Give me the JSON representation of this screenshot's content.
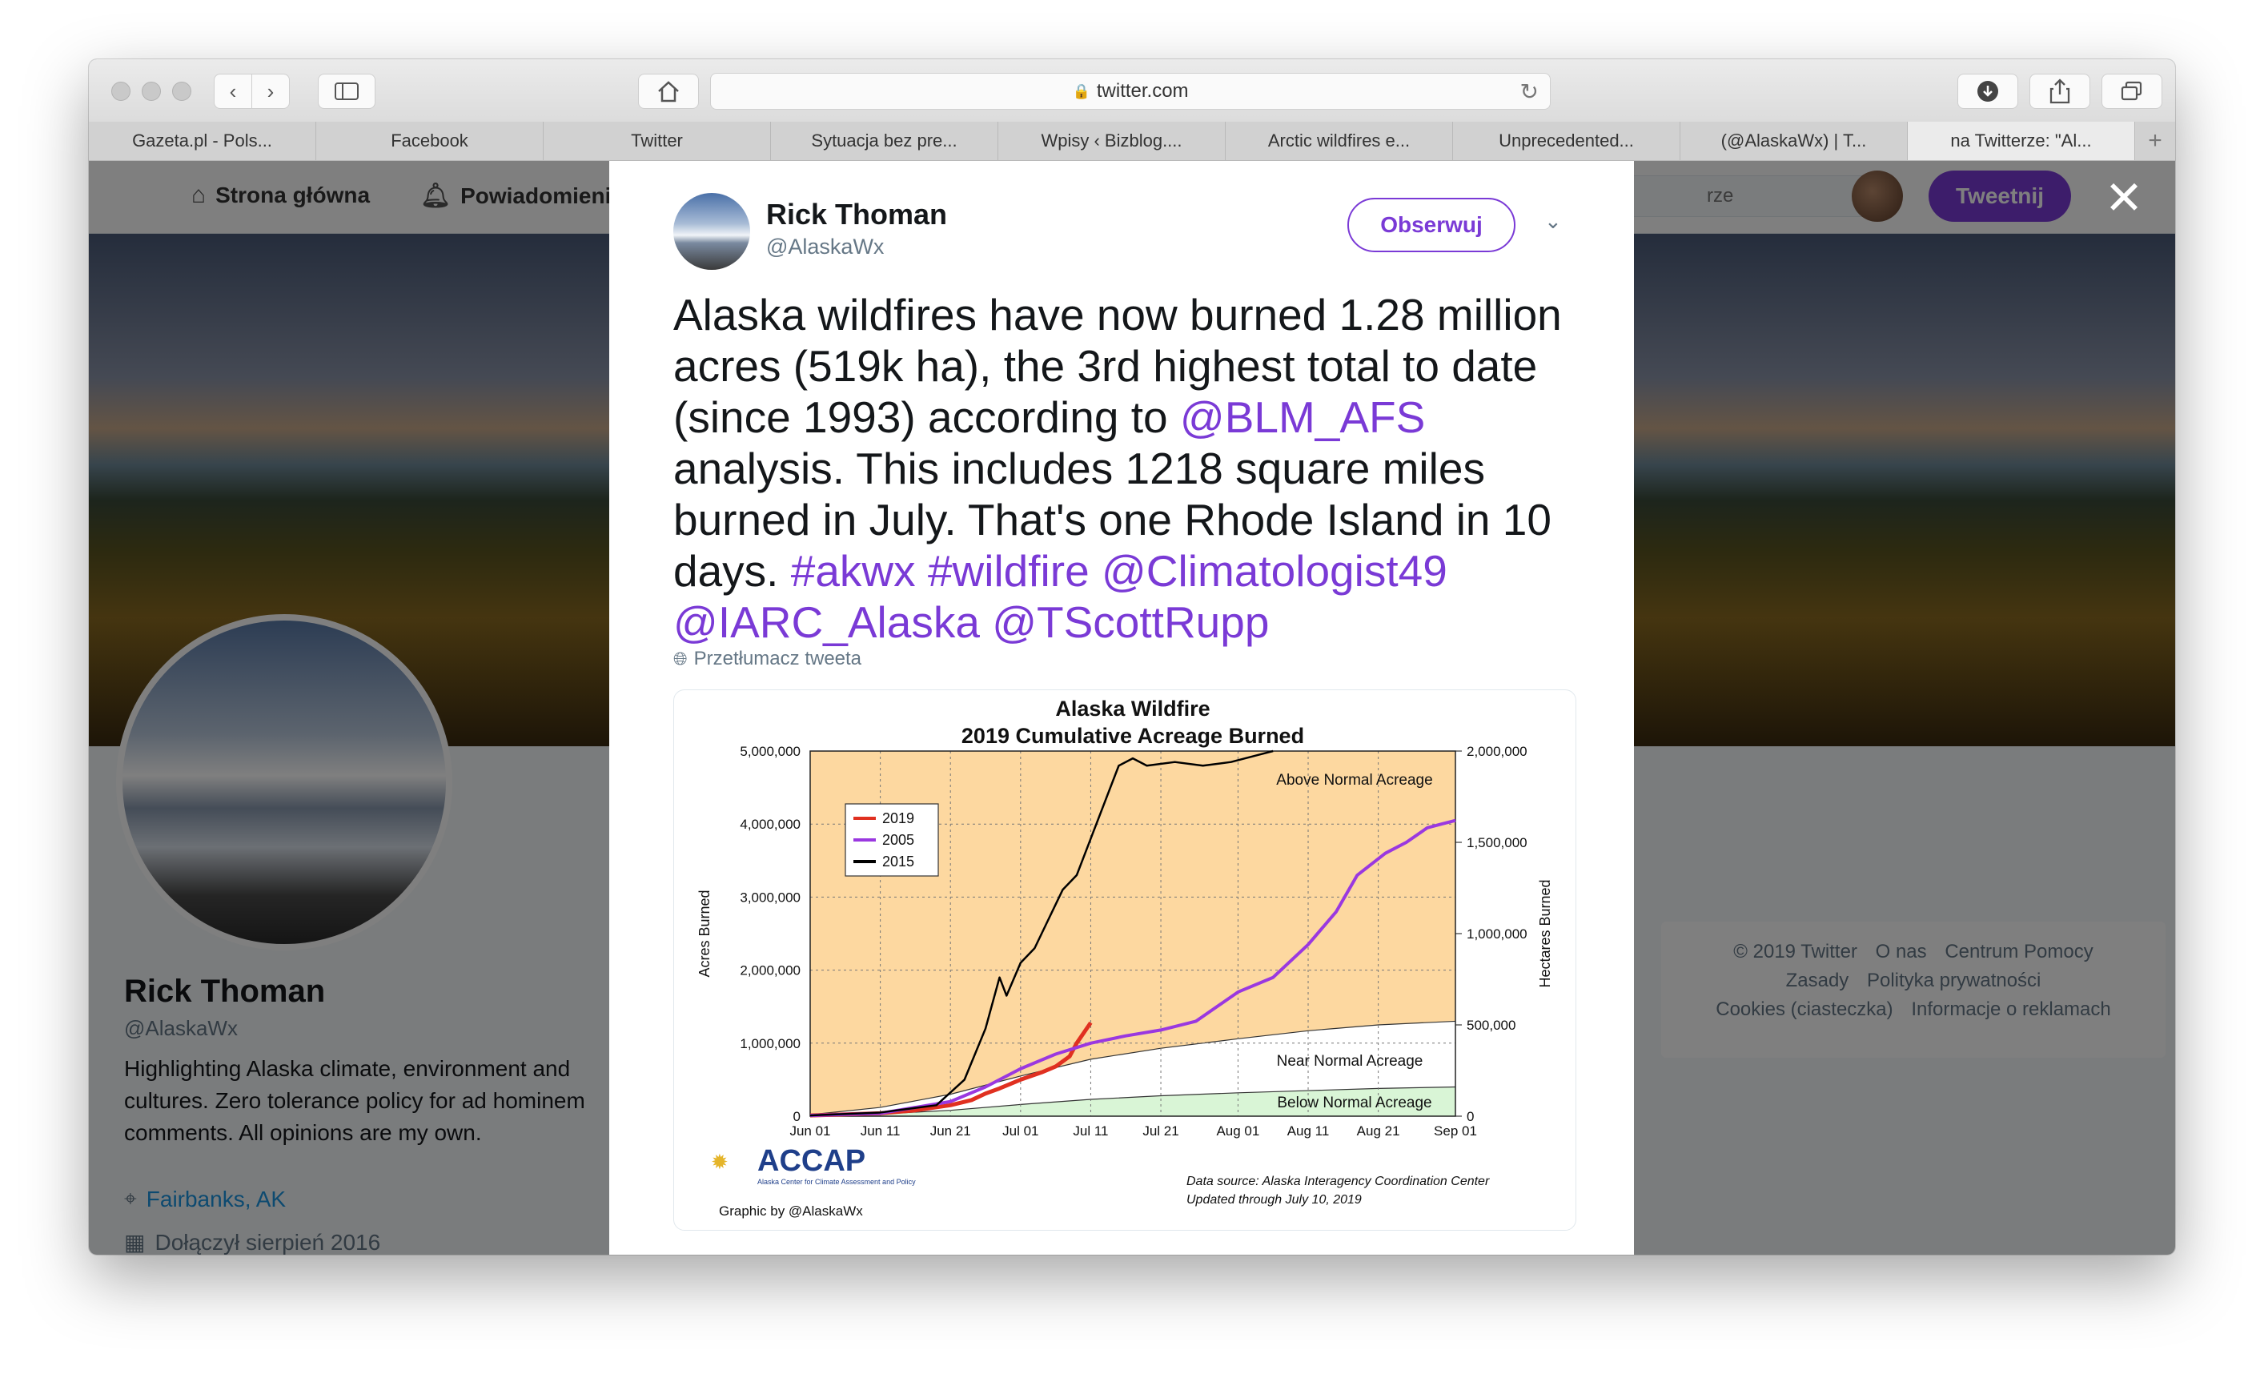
{
  "browser": {
    "address": "twitter.com",
    "tabs": [
      {
        "label": "Gazeta.pl - Pols...",
        "active": false
      },
      {
        "label": "Facebook",
        "active": false
      },
      {
        "label": "Twitter",
        "active": false
      },
      {
        "label": "Sytuacja bez pre...",
        "active": false
      },
      {
        "label": "Wpisy ‹ Bizblog....",
        "active": false
      },
      {
        "label": "Arctic wildfires e...",
        "active": false
      },
      {
        "label": "Unprecedented...",
        "active": false
      },
      {
        "label": "(@AlaskaWx) | T...",
        "active": false
      },
      {
        "label": "na Twitterze: \"Al...",
        "active": true
      }
    ]
  },
  "nav": {
    "home": "Strona główna",
    "notifications": "Powiadomienia",
    "search_placeholder": "rze",
    "tweet_button": "Tweetnij"
  },
  "profile": {
    "name": "Rick Thoman",
    "handle": "@AlaskaWx",
    "bio": "Highlighting Alaska climate, environment and cultures. Zero tolerance policy for ad hominem comments. All opinions are my own.",
    "location": "Fairbanks, AK",
    "joined": "Dołączył sierpień 2016"
  },
  "footer": {
    "line1": [
      "© 2019 Twitter",
      "O nas",
      "Centrum Pomocy"
    ],
    "line2": [
      "Zasady",
      "Polityka prywatności"
    ],
    "line3": [
      "Cookies (ciasteczka)",
      "Informacje o reklamach"
    ]
  },
  "tweet": {
    "author_name": "Rick Thoman",
    "author_handle": "@AlaskaWx",
    "follow_label": "Obserwuj",
    "text_parts": [
      {
        "t": "Alaska wildfires have now burned 1.28 million acres (519k ha), the 3rd highest total to date (since 1993) according to ",
        "link": false
      },
      {
        "t": "@BLM_AFS",
        "link": true
      },
      {
        "t": " analysis. This includes 1218 square miles burned in July. That's one Rhode Island in 10 days. ",
        "link": false
      },
      {
        "t": "#akwx",
        "link": true
      },
      {
        "t": " ",
        "link": false
      },
      {
        "t": "#wildfire",
        "link": true
      },
      {
        "t": " ",
        "link": false
      },
      {
        "t": "@Climatologist49",
        "link": true
      },
      {
        "t": " ",
        "link": false
      },
      {
        "t": "@IARC_Alaska",
        "link": true
      },
      {
        "t": " ",
        "link": false
      },
      {
        "t": "@TScottRupp",
        "link": true
      }
    ],
    "translate_label": "Przetłumacz tweeta",
    "link_color": "#7a3ad6"
  },
  "chart_data": {
    "type": "line",
    "title": "Alaska Wildfire",
    "subtitle": "2019 Cumulative Acreage Burned",
    "ylabel": "Acres Burned",
    "y2label": "Hectares Burned",
    "ylim": [
      0,
      5000000
    ],
    "y2lim": [
      0,
      2000000
    ],
    "y_ticks": [
      "0",
      "1,000,000",
      "2,000,000",
      "3,000,000",
      "4,000,000",
      "5,000,000"
    ],
    "y2_ticks": [
      "0",
      "500,000",
      "1,000,000",
      "1,500,000",
      "2,000,000"
    ],
    "x_ticks": [
      "Jun 01",
      "Jun 11",
      "Jun 21",
      "Jul 01",
      "Jul 11",
      "Jul 21",
      "Aug 01",
      "Aug 11",
      "Aug 21",
      "Sep 01"
    ],
    "x_tick_days": [
      0,
      10,
      20,
      30,
      40,
      50,
      61,
      71,
      81,
      92
    ],
    "x_range_days": [
      0,
      92
    ],
    "region_labels": [
      "Above Normal Acreage",
      "Near Normal Acreage",
      "Below Normal Acreage"
    ],
    "bands": {
      "x": [
        0,
        10,
        20,
        30,
        40,
        50,
        61,
        71,
        81,
        92
      ],
      "upper_normal": [
        20000,
        120000,
        300000,
        550000,
        780000,
        930000,
        1060000,
        1170000,
        1250000,
        1300000
      ],
      "lower_normal": [
        5000,
        30000,
        80000,
        160000,
        230000,
        280000,
        320000,
        350000,
        380000,
        400000
      ]
    },
    "series": [
      {
        "name": "2019",
        "color": "#e03020",
        "x": [
          0,
          10,
          15,
          20,
          23,
          25,
          27,
          30,
          33,
          35,
          37,
          38,
          40
        ],
        "values": [
          10000,
          40000,
          80000,
          150000,
          220000,
          310000,
          380000,
          500000,
          600000,
          680000,
          820000,
          1000000,
          1280000
        ]
      },
      {
        "name": "2005",
        "color": "#9a38e0",
        "x": [
          0,
          10,
          20,
          25,
          30,
          35,
          40,
          45,
          50,
          55,
          61,
          66,
          71,
          75,
          78,
          82,
          85,
          88,
          90,
          92
        ],
        "values": [
          10000,
          40000,
          200000,
          400000,
          650000,
          850000,
          1000000,
          1100000,
          1180000,
          1300000,
          1700000,
          1900000,
          2350000,
          2800000,
          3300000,
          3600000,
          3750000,
          3950000,
          4000000,
          4050000
        ]
      },
      {
        "name": "2015",
        "color": "#000000",
        "x": [
          0,
          10,
          18,
          22,
          25,
          27,
          28,
          30,
          32,
          34,
          36,
          38,
          40,
          42,
          44,
          46,
          48,
          52,
          56,
          60,
          64,
          66
        ],
        "values": [
          10000,
          50000,
          150000,
          500000,
          1200000,
          1900000,
          1650000,
          2100000,
          2300000,
          2700000,
          3100000,
          3300000,
          3800000,
          4300000,
          4800000,
          4900000,
          4800000,
          4850000,
          4800000,
          4850000,
          4950000,
          5000000
        ]
      }
    ],
    "legend_placement": "top-left",
    "grid": true,
    "logo_text": "ACCAP",
    "logo_subtext": "Alaska Center for Climate Assessment and Policy",
    "credit": "Graphic by @AlaskaWx",
    "source_line1": "Data source: Alaska Interagency Coordination Center",
    "source_line2": "Updated through July 10, 2019",
    "colors": {
      "above": "#fdd8a0",
      "near": "#ffffff",
      "below": "#d9f5d6",
      "band_line": "#333333",
      "grid": "#777777"
    }
  }
}
